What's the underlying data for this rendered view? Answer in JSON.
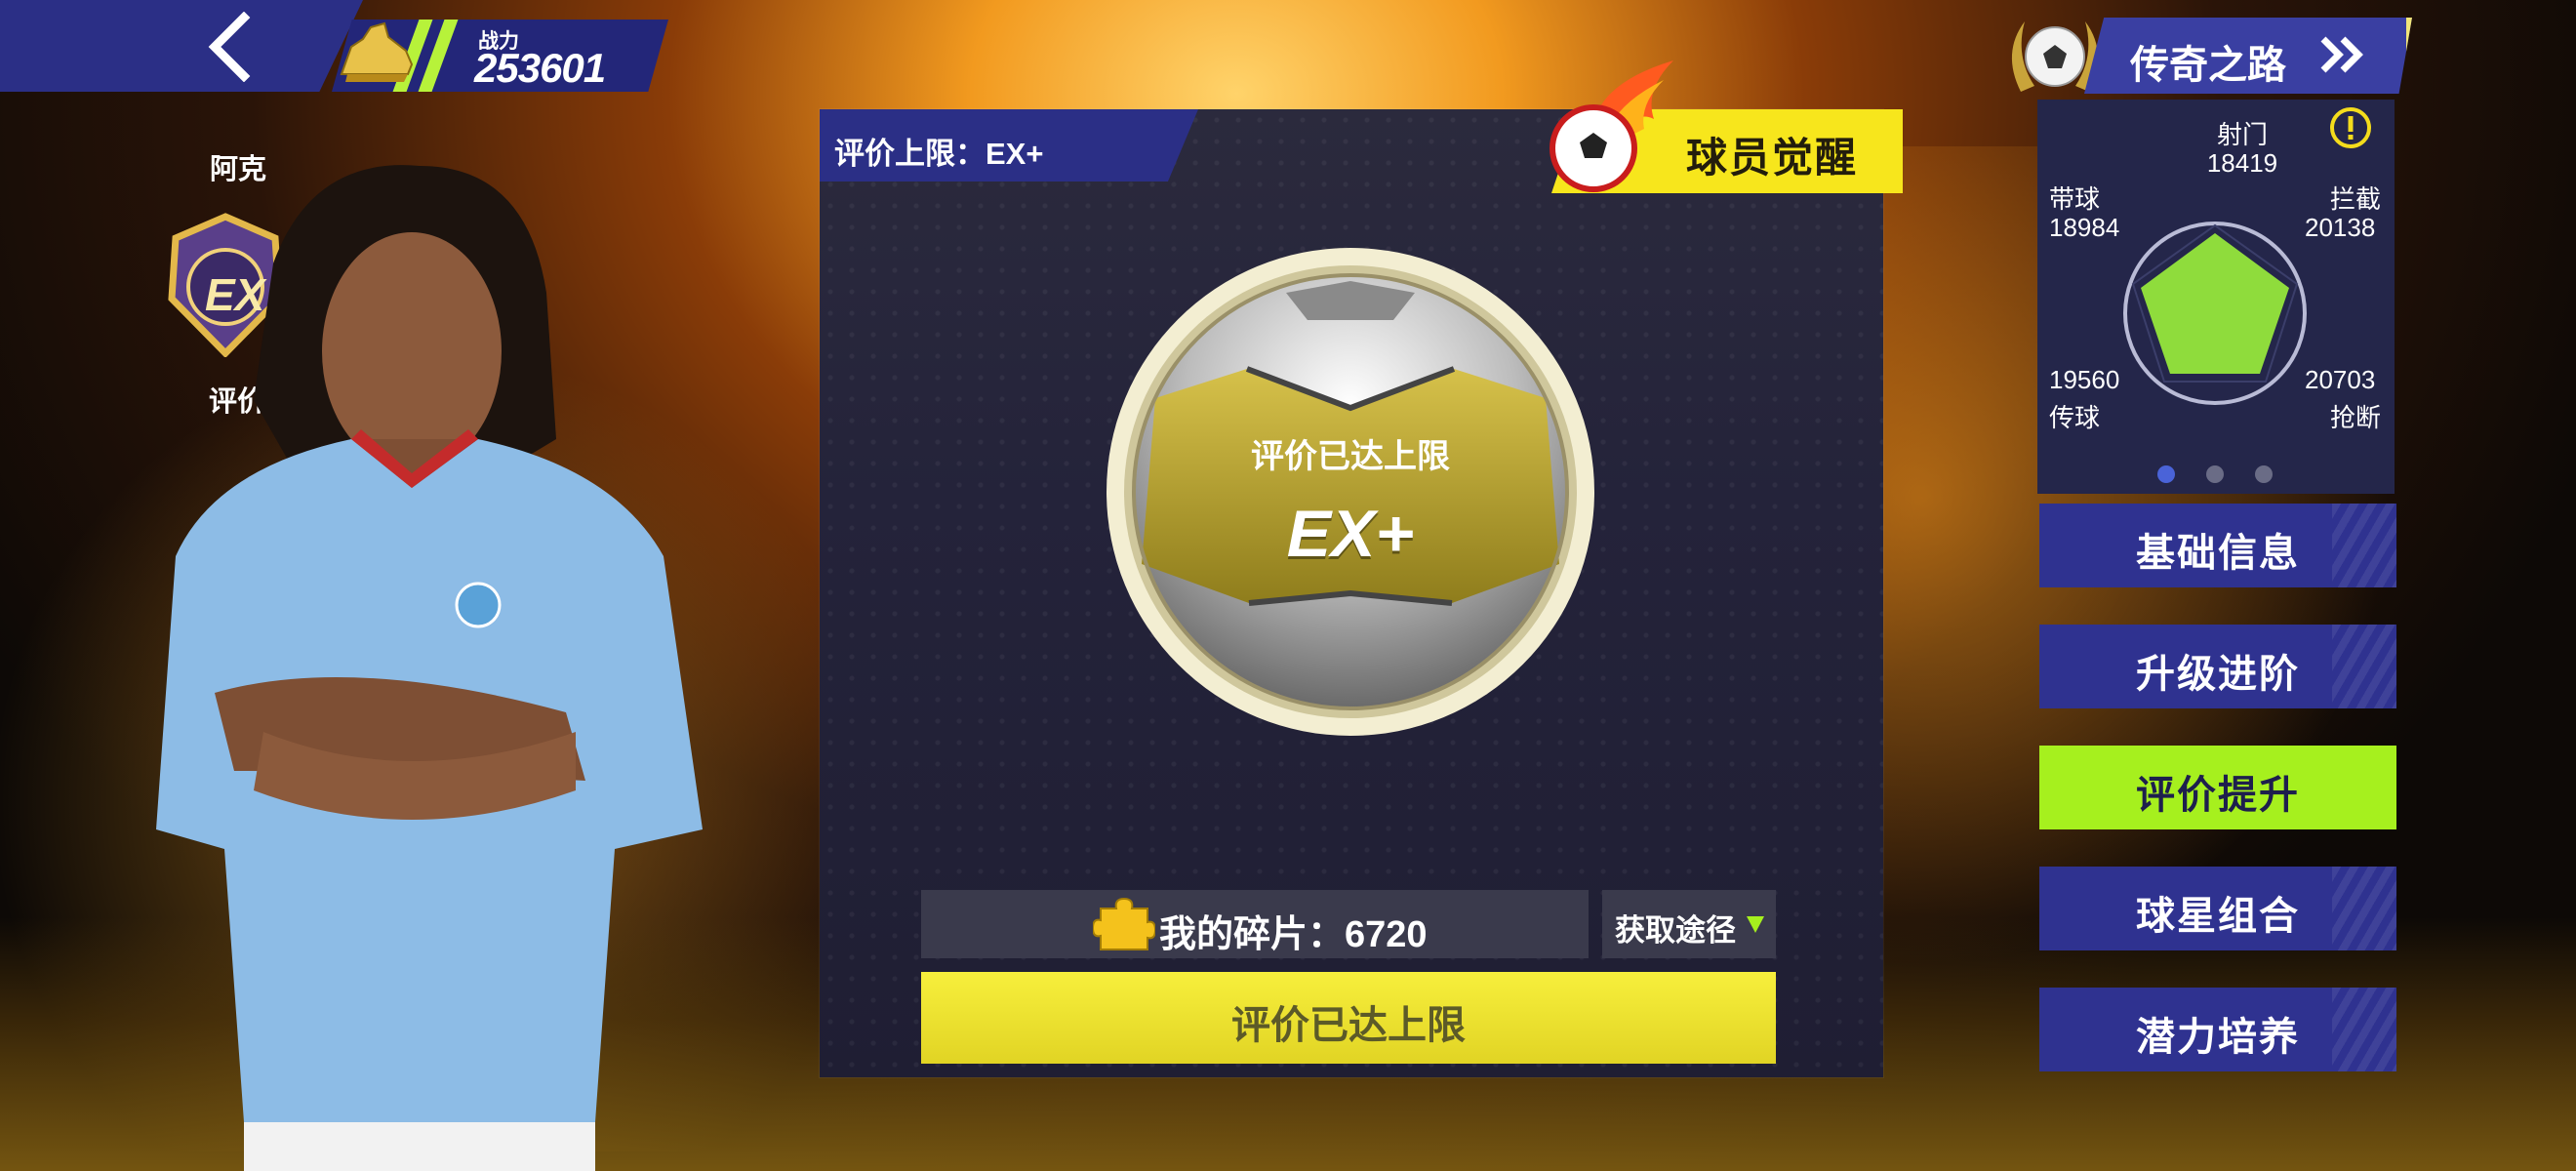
{
  "header": {
    "power_label": "战力",
    "power_value": "253601"
  },
  "player": {
    "name": "阿克",
    "rating_badge": "EX",
    "side_label": "评价"
  },
  "panel": {
    "rating_limit_label": "评价上限：EX+",
    "awaken_button": "球员觉醒",
    "ball_status": "评价已达上限",
    "ball_rating": "EX+",
    "fragments_label": "我的碎片：6720",
    "source_button": "获取途径",
    "maxed_button": "评价已达上限"
  },
  "legend": {
    "title": "传奇之路"
  },
  "stats": {
    "shooting": {
      "label": "射门",
      "value": "18419"
    },
    "dribbling": {
      "label": "带球",
      "value": "18984"
    },
    "interception": {
      "label": "拦截",
      "value": "20138"
    },
    "passing": {
      "label": "传球",
      "value": "19560"
    },
    "tackling": {
      "label": "抢断",
      "value": "20703"
    }
  },
  "menu": {
    "items": [
      {
        "label": "基础信息"
      },
      {
        "label": "升级进阶"
      },
      {
        "label": "评价提升",
        "active": true
      },
      {
        "label": "球星组合"
      },
      {
        "label": "潜力培养"
      }
    ]
  },
  "colors": {
    "accent_green": "#a6f01e",
    "accent_yellow": "#f7e61c",
    "nav_blue": "#2f3290",
    "radar_fill": "#8fdc3c"
  }
}
